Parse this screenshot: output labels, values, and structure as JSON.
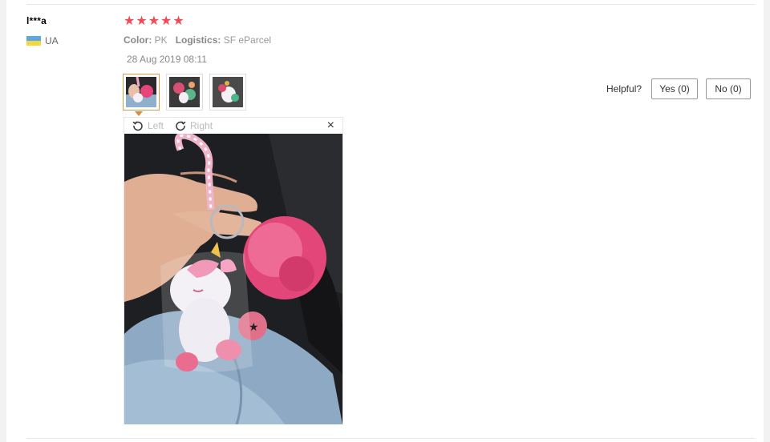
{
  "review": {
    "user": "l***a",
    "country_code": "UA",
    "rating": 5,
    "color_label": "Color:",
    "color_value": "PK",
    "logistics_label": "Logistics:",
    "logistics_value": "SF eParcel",
    "date": "28 Aug 2019 08:11"
  },
  "viewer": {
    "left_label": "Left",
    "right_label": "Right",
    "close_glyph": "×"
  },
  "helpful": {
    "label": "Helpful?",
    "yes": "Yes (0)",
    "no": "No (0)"
  },
  "colors": {
    "star": "#f14b57",
    "active_thumb_border": "#d39a4a"
  },
  "icons": [
    "star-icon",
    "ukraine-flag-icon",
    "rotate-left-icon",
    "rotate-right-icon",
    "close-icon"
  ]
}
